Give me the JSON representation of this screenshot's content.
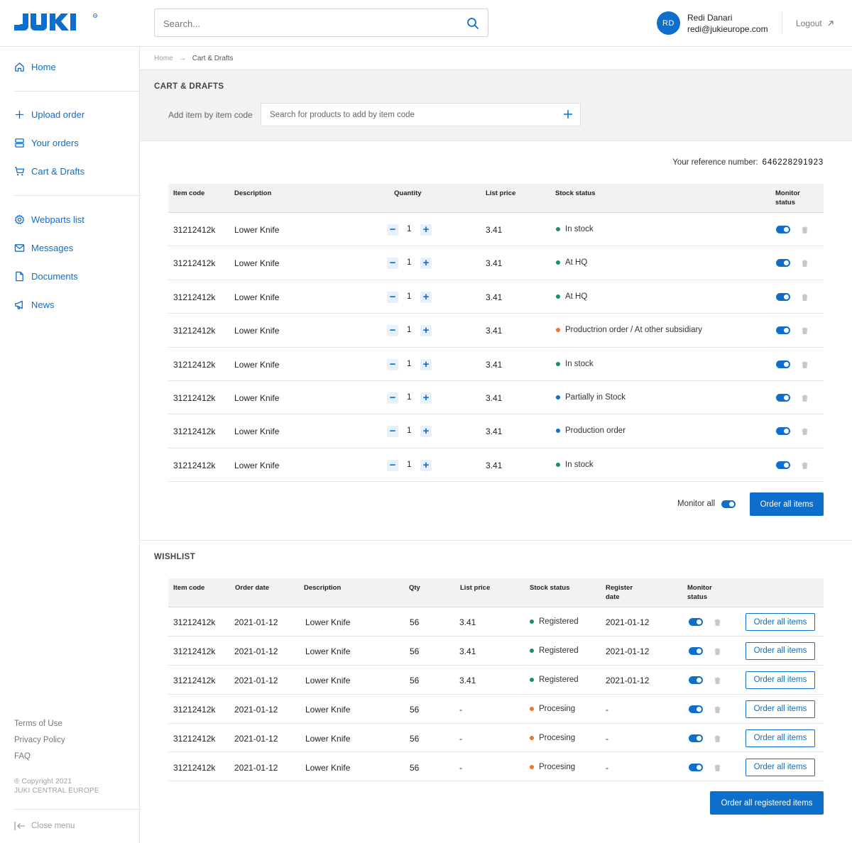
{
  "brand": {
    "logo_text": "JUKI",
    "accent": "#0d6ecb"
  },
  "header": {
    "search_placeholder": "Search...",
    "user": {
      "initials": "RD",
      "name": "Redi Danari",
      "email": "redi@jukieurope.com"
    },
    "logout_label": "Logout"
  },
  "sidebar": {
    "items": [
      {
        "label": "Home",
        "icon": "home-icon"
      },
      {
        "label": "Upload order",
        "icon": "plus-icon"
      },
      {
        "label": "Your orders",
        "icon": "list-icon"
      },
      {
        "label": "Cart & Drafts",
        "icon": "cart-icon"
      },
      {
        "label": "Webparts list",
        "icon": "gear-icon"
      },
      {
        "label": "Messages",
        "icon": "mail-icon"
      },
      {
        "label": "Documents",
        "icon": "document-icon"
      },
      {
        "label": "News",
        "icon": "megaphone-icon"
      }
    ],
    "footer_links": [
      "Terms of Use",
      "Privacy Policy",
      "FAQ"
    ],
    "copyright_line1": "® Copyright 2021",
    "copyright_line2": "JUKI CENTRAL EUROPE",
    "close_menu_label": "Close menu"
  },
  "breadcrumb": {
    "home": "Home",
    "arrow": "→",
    "current": "Cart & Drafts"
  },
  "cart": {
    "title": "CART & DRAFTS",
    "add_label": "Add item by item code",
    "add_placeholder": "Search for products to add by item code",
    "reference_label": "Your reference number:",
    "reference_number": "646228291923",
    "columns": {
      "item_code": "Item code",
      "description": "Description",
      "quantity": "Quantity",
      "list_price": "List price",
      "stock_status": "Stock status",
      "monitor_1": "Monitor",
      "monitor_2": "status"
    },
    "minus": "−",
    "plus": "+",
    "rows": [
      {
        "code": "31212412k",
        "desc": "Lower Knife",
        "qty": "1",
        "price": "3.41",
        "status": "In stock",
        "color": "#1a8f5a"
      },
      {
        "code": "31212412k",
        "desc": "Lower Knife",
        "qty": "1",
        "price": "3.41",
        "status": "At HQ",
        "color": "#1a8f5a"
      },
      {
        "code": "31212412k",
        "desc": "Lower Knife",
        "qty": "1",
        "price": "3.41",
        "status": "At HQ",
        "color": "#1a8f5a"
      },
      {
        "code": "31212412k",
        "desc": "Lower Knife",
        "qty": "1",
        "price": "3.41",
        "status": "Productrion order / At other subsidiary",
        "color": "#e8762c"
      },
      {
        "code": "31212412k",
        "desc": "Lower Knife",
        "qty": "1",
        "price": "3.41",
        "status": "In stock",
        "color": "#1a8f5a"
      },
      {
        "code": "31212412k",
        "desc": "Lower Knife",
        "qty": "1",
        "price": "3.41",
        "status": "Partially in Stock",
        "color": "#0d6ecb"
      },
      {
        "code": "31212412k",
        "desc": "Lower Knife",
        "qty": "1",
        "price": "3.41",
        "status": "Production order",
        "color": "#0d6ecb"
      },
      {
        "code": "31212412k",
        "desc": "Lower Knife",
        "qty": "1",
        "price": "3.41",
        "status": "In stock",
        "color": "#1a8f5a"
      }
    ],
    "monitor_all_label": "Monitor all",
    "order_all_label": "Order all items"
  },
  "wishlist": {
    "title": "WISHLIST",
    "columns": {
      "item_code": "Item code",
      "order_date": "Order date",
      "description": "Description",
      "qty": "Qty",
      "list_price": "List price",
      "stock_status": "Stock status",
      "register_1": "Register",
      "register_2": "date",
      "monitor_1": "Monitor",
      "monitor_2": "status"
    },
    "rows": [
      {
        "code": "31212412k",
        "date": "2021-01-12",
        "desc": "Lower Knife",
        "qty": "56",
        "price": "3.41",
        "status": "Registered",
        "color": "#1a8f5a",
        "reg": "2021-01-12"
      },
      {
        "code": "31212412k",
        "date": "2021-01-12",
        "desc": "Lower Knife",
        "qty": "56",
        "price": "3.41",
        "status": "Registered",
        "color": "#1a8f5a",
        "reg": "2021-01-12"
      },
      {
        "code": "31212412k",
        "date": "2021-01-12",
        "desc": "Lower Knife",
        "qty": "56",
        "price": "3.41",
        "status": "Registered",
        "color": "#1a8f5a",
        "reg": "2021-01-12"
      },
      {
        "code": "31212412k",
        "date": "2021-01-12",
        "desc": "Lower Knife",
        "qty": "56",
        "price": "-",
        "status": "Procesing",
        "color": "#e8762c",
        "reg": "-"
      },
      {
        "code": "31212412k",
        "date": "2021-01-12",
        "desc": "Lower Knife",
        "qty": "56",
        "price": "-",
        "status": "Procesing",
        "color": "#e8762c",
        "reg": "-"
      },
      {
        "code": "31212412k",
        "date": "2021-01-12",
        "desc": "Lower Knife",
        "qty": "56",
        "price": "-",
        "status": "Procesing",
        "color": "#e8762c",
        "reg": "-"
      }
    ],
    "row_button_label": "Order all items",
    "order_registered_label": "Order all registered items"
  }
}
